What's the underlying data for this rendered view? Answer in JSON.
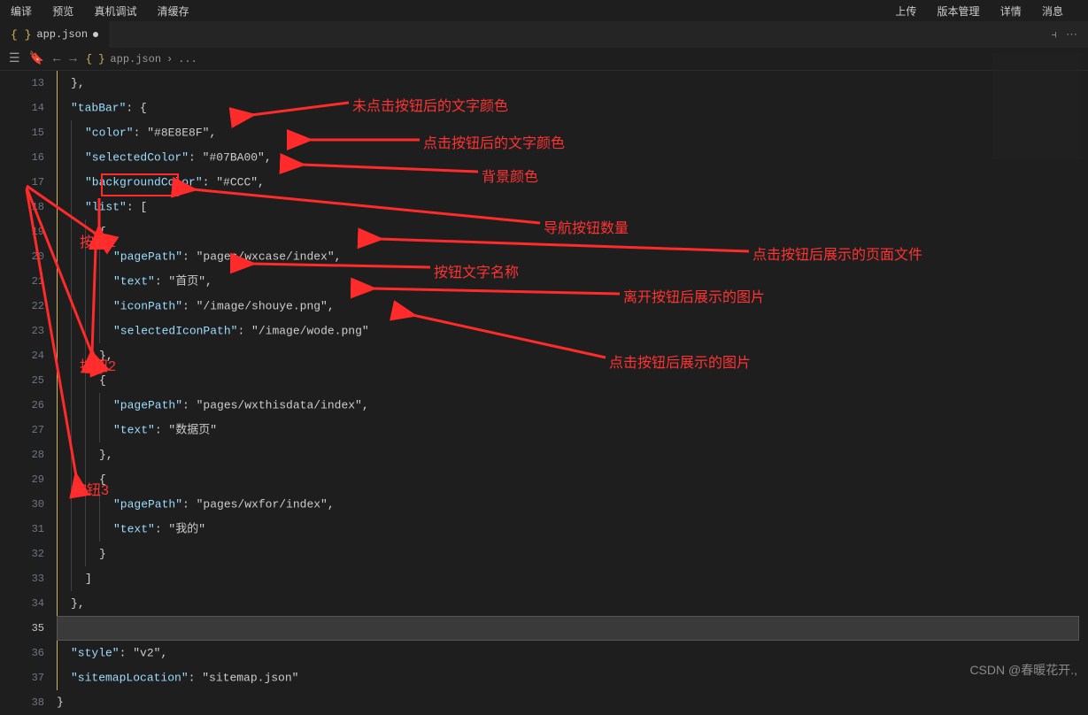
{
  "top_menu": {
    "left": [
      "编译",
      "预览",
      "真机调试",
      "清缓存"
    ],
    "right": [
      "上传",
      "版本管理",
      "详情",
      "消息"
    ]
  },
  "tab": {
    "name": "app.json",
    "modified": true
  },
  "breadcrumb": {
    "file": "app.json",
    "chev": "›",
    "ellipsis": "..."
  },
  "line_start": 13,
  "code_lines": [
    "  },",
    "  \"tabBar\": {",
    "    \"color\": \"#8E8E8F\",",
    "    \"selectedColor\": \"#07BA00\",",
    "    \"backgroundColor\": \"#CCC\",",
    "    \"list\": [",
    "      {",
    "        \"pagePath\": \"pages/wxcase/index\",",
    "        \"text\": \"首页\",",
    "        \"iconPath\": \"/image/shouye.png\",",
    "        \"selectedIconPath\": \"/image/wode.png\"",
    "      },",
    "      {",
    "        \"pagePath\": \"pages/wxthisdata/index\",",
    "        \"text\": \"数据页\"",
    "      },",
    "      {",
    "        \"pagePath\": \"pages/wxfor/index\",",
    "        \"text\": \"我的\"",
    "      }",
    "    ]",
    "  },",
    "",
    "  \"style\": \"v2\",",
    "  \"sitemapLocation\": \"sitemap.json\"",
    "}"
  ],
  "annotations": {
    "color": "未点击按钮后的文字颜色",
    "selectedColor": "点击按钮后的文字颜色",
    "backgroundColor": "背景颜色",
    "list": "导航按钮数量",
    "pagePath": "点击按钮后展示的页面文件",
    "text": "按钮文字名称",
    "iconPath": "离开按钮后展示的图片",
    "selectedIconPath": "点击按钮后展示的图片",
    "btn1": "按钮1",
    "btn2": "按钮2",
    "btn3": "按钮3"
  },
  "watermark": "CSDN @春暖花开.,"
}
